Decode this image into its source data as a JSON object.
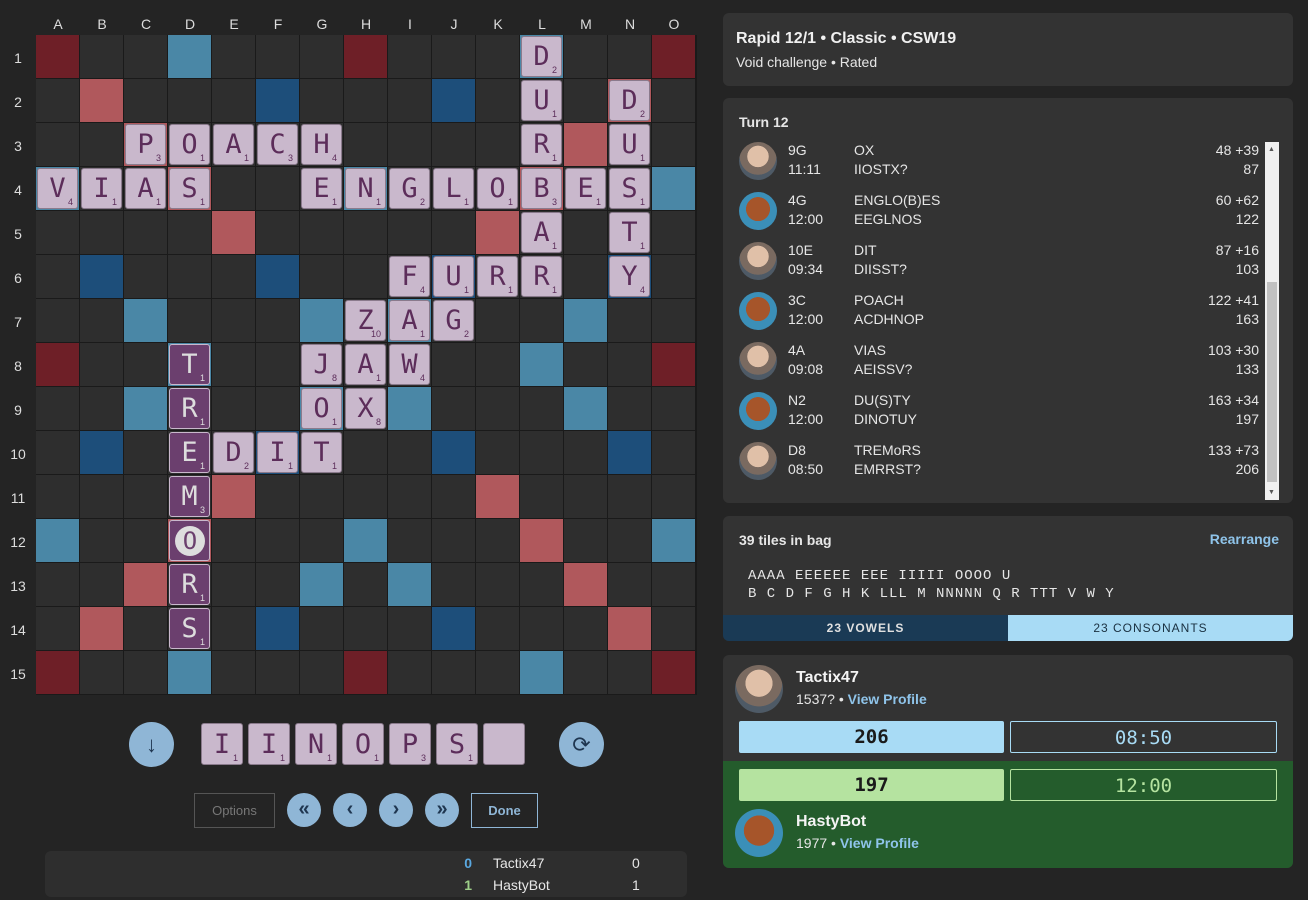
{
  "board": {
    "columns": [
      "A",
      "B",
      "C",
      "D",
      "E",
      "F",
      "G",
      "H",
      "I",
      "J",
      "K",
      "L",
      "M",
      "N",
      "O"
    ],
    "rows": [
      "1",
      "2",
      "3",
      "4",
      "5",
      "6",
      "7",
      "8",
      "9",
      "10",
      "11",
      "12",
      "13",
      "14",
      "15"
    ],
    "tiles": [
      {
        "pos": "L1",
        "letter": "D",
        "score": "2"
      },
      {
        "pos": "L2",
        "letter": "U",
        "score": "1"
      },
      {
        "pos": "N2",
        "letter": "D",
        "score": "2"
      },
      {
        "pos": "C3",
        "letter": "P",
        "score": "3"
      },
      {
        "pos": "D3",
        "letter": "O",
        "score": "1"
      },
      {
        "pos": "E3",
        "letter": "A",
        "score": "1"
      },
      {
        "pos": "F3",
        "letter": "C",
        "score": "3"
      },
      {
        "pos": "G3",
        "letter": "H",
        "score": "4"
      },
      {
        "pos": "L3",
        "letter": "R",
        "score": "1"
      },
      {
        "pos": "N3",
        "letter": "U",
        "score": "1"
      },
      {
        "pos": "A4",
        "letter": "V",
        "score": "4"
      },
      {
        "pos": "B4",
        "letter": "I",
        "score": "1"
      },
      {
        "pos": "C4",
        "letter": "A",
        "score": "1"
      },
      {
        "pos": "D4",
        "letter": "S",
        "score": "1"
      },
      {
        "pos": "G4",
        "letter": "E",
        "score": "1"
      },
      {
        "pos": "H4",
        "letter": "N",
        "score": "1"
      },
      {
        "pos": "I4",
        "letter": "G",
        "score": "2"
      },
      {
        "pos": "J4",
        "letter": "L",
        "score": "1"
      },
      {
        "pos": "K4",
        "letter": "O",
        "score": "1"
      },
      {
        "pos": "L4",
        "letter": "B",
        "score": "3"
      },
      {
        "pos": "M4",
        "letter": "E",
        "score": "1"
      },
      {
        "pos": "N4",
        "letter": "S",
        "score": "1"
      },
      {
        "pos": "L5",
        "letter": "A",
        "score": "1"
      },
      {
        "pos": "N5",
        "letter": "T",
        "score": "1"
      },
      {
        "pos": "I6",
        "letter": "F",
        "score": "4"
      },
      {
        "pos": "J6",
        "letter": "U",
        "score": "1"
      },
      {
        "pos": "K6",
        "letter": "R",
        "score": "1"
      },
      {
        "pos": "L6",
        "letter": "R",
        "score": "1"
      },
      {
        "pos": "N6",
        "letter": "Y",
        "score": "4"
      },
      {
        "pos": "H7",
        "letter": "Z",
        "score": "10"
      },
      {
        "pos": "I7",
        "letter": "A",
        "score": "1"
      },
      {
        "pos": "J7",
        "letter": "G",
        "score": "2"
      },
      {
        "pos": "D8",
        "letter": "T",
        "score": "1",
        "new": true
      },
      {
        "pos": "G8",
        "letter": "J",
        "score": "8"
      },
      {
        "pos": "H8",
        "letter": "A",
        "score": "1"
      },
      {
        "pos": "I8",
        "letter": "W",
        "score": "4"
      },
      {
        "pos": "D9",
        "letter": "R",
        "score": "1",
        "new": true
      },
      {
        "pos": "G9",
        "letter": "O",
        "score": "1"
      },
      {
        "pos": "H9",
        "letter": "X",
        "score": "8"
      },
      {
        "pos": "D10",
        "letter": "E",
        "score": "1",
        "new": true
      },
      {
        "pos": "E10",
        "letter": "D",
        "score": "2"
      },
      {
        "pos": "F10",
        "letter": "I",
        "score": "1"
      },
      {
        "pos": "G10",
        "letter": "T",
        "score": "1"
      },
      {
        "pos": "D11",
        "letter": "M",
        "score": "3",
        "new": true
      },
      {
        "pos": "D12",
        "letter": "O",
        "score": "",
        "new": true,
        "blank": true
      },
      {
        "pos": "D13",
        "letter": "R",
        "score": "1",
        "new": true
      },
      {
        "pos": "D14",
        "letter": "S",
        "score": "1",
        "new": true
      }
    ]
  },
  "rack": [
    {
      "letter": "I",
      "score": "1"
    },
    {
      "letter": "I",
      "score": "1"
    },
    {
      "letter": "N",
      "score": "1"
    },
    {
      "letter": "O",
      "score": "1"
    },
    {
      "letter": "P",
      "score": "3"
    },
    {
      "letter": "S",
      "score": "1"
    },
    {
      "letter": "",
      "score": ""
    }
  ],
  "controls": {
    "options_label": "Options",
    "done_label": "Done",
    "first_glyph": "«",
    "prev_glyph": "‹",
    "next_glyph": "›",
    "last_glyph": "»",
    "down_glyph": "↓",
    "exchange_glyph": "⟳"
  },
  "mini_scores": [
    {
      "value": "0",
      "name": "Tactix47",
      "right": "0"
    },
    {
      "value": "1",
      "name": "HastyBot",
      "right": "1"
    }
  ],
  "info": {
    "title": "Rapid 12/1 • Classic • CSW19",
    "subtitle": "Void challenge • Rated"
  },
  "turns": {
    "title": "Turn 12",
    "rows": [
      {
        "player": "tactix",
        "pos": "9G",
        "time": "11:11",
        "word": "OX",
        "rack": "IIOSTX?",
        "score": "48 +39",
        "total": "87"
      },
      {
        "player": "hasty",
        "pos": "4G",
        "time": "12:00",
        "word": "ENGLO(B)ES",
        "rack": "EEGLNOS",
        "score": "60 +62",
        "total": "122"
      },
      {
        "player": "tactix",
        "pos": "10E",
        "time": "09:34",
        "word": "DIT",
        "rack": "DIISST?",
        "score": "87 +16",
        "total": "103"
      },
      {
        "player": "hasty",
        "pos": "3C",
        "time": "12:00",
        "word": "POACH",
        "rack": "ACDHNOP",
        "score": "122 +41",
        "total": "163"
      },
      {
        "player": "tactix",
        "pos": "4A",
        "time": "09:08",
        "word": "VIAS",
        "rack": "AEISSV?",
        "score": "103 +30",
        "total": "133"
      },
      {
        "player": "hasty",
        "pos": "N2",
        "time": "12:00",
        "word": "DU(S)TY",
        "rack": "DINOTUY",
        "score": "163 +34",
        "total": "197"
      },
      {
        "player": "tactix",
        "pos": "D8",
        "time": "08:50",
        "word": "TREMoRS",
        "rack": "EMRRST?",
        "score": "133 +73",
        "total": "206"
      }
    ]
  },
  "bag": {
    "title": "39 tiles in bag",
    "rearrange": "Rearrange",
    "vowels_line": "AAAA EEEEEE EEE IIIII OOOO U",
    "consonants_line": "B C D F G H K LLL M NNNNN Q R TTT V W Y",
    "vowels_tab": "23 VOWELS",
    "consonants_tab": "23 CONSONANTS"
  },
  "players": {
    "p1": {
      "name": "Tactix47",
      "rating": "1537? •",
      "link": "View Profile",
      "score": "206",
      "clock": "08:50"
    },
    "p2": {
      "name": "HastyBot",
      "rating": "1977 •",
      "link": "View Profile",
      "score": "197",
      "clock": "12:00"
    }
  },
  "colors": {
    "tw": "#6e1f27",
    "dw": "#b0585c",
    "tl": "#1d4e7a",
    "dl": "#4a87a6",
    "tile": "#c9b8cc",
    "new_tile": "#6b3f6e",
    "accent": "#8fb6d6",
    "p1_score_bg": "#a8dbf5",
    "p2_score_bg": "#b5e3a0"
  }
}
